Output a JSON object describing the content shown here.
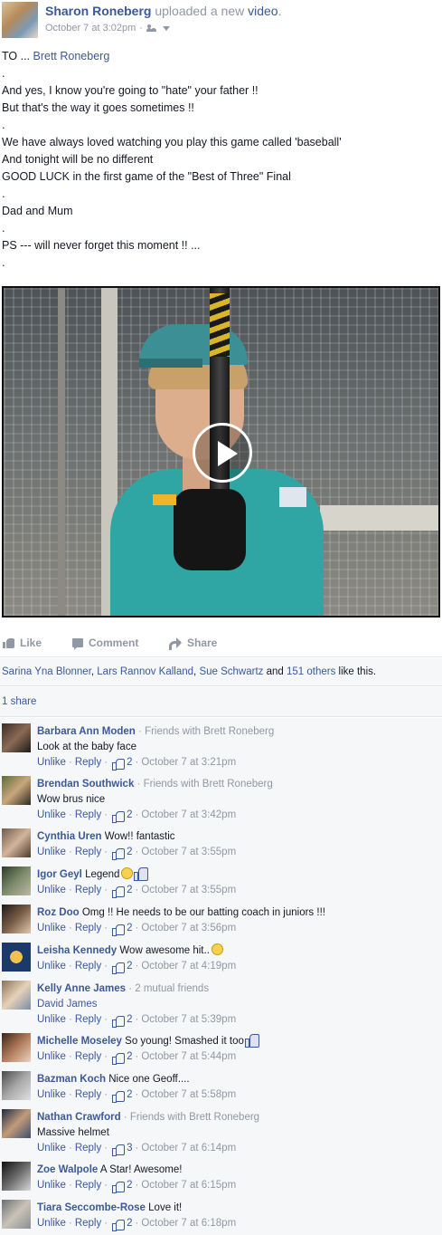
{
  "post": {
    "author": "Sharon Roneberg",
    "action_prefix": "uploaded a new",
    "action_link": "video",
    "action_suffix": ".",
    "timestamp": "October 7 at 3:02pm",
    "meta_separator": "·",
    "audience_icon": "friends-icon"
  },
  "text": {
    "to_prefix": "TO ... ",
    "to_name": "Brett Roneberg",
    "lines": [
      ".",
      "And yes, I know you're going to \"hate\" your father !!",
      "But that's the way it goes sometimes !!",
      ".",
      "We have always loved watching you play this game called 'baseball'",
      "And tonight will be no different",
      "GOOD LUCK in the first game of the \"Best of Three\" Final",
      ".",
      "Dad and Mum",
      ".",
      "PS --- will never forget this moment !! ...",
      "."
    ]
  },
  "actions": {
    "like": "Like",
    "comment": "Comment",
    "share": "Share"
  },
  "likes": {
    "names": [
      "Sarina Yna Blonner",
      "Lars Rannov Kalland",
      "Sue Schwartz"
    ],
    "sep1": ", ",
    "sep2": ", ",
    "and": " and ",
    "others": "151 others",
    "suffix": " like this."
  },
  "shares": {
    "label": "1 share"
  },
  "comments": [
    {
      "name": "Barbara Ann Moden",
      "note": "· Friends with Brett Roneberg",
      "text": "Look at the baby face",
      "unlike": "Unlike",
      "reply": "Reply",
      "likes": "2",
      "time": "October 7 at 3:21pm"
    },
    {
      "name": "Brendan Southwick",
      "note": "· Friends with Brett Roneberg",
      "text": "Wow brus nice",
      "unlike": "Unlike",
      "reply": "Reply",
      "likes": "2",
      "time": "October 7 at 3:42pm"
    },
    {
      "name": "Cynthia Uren",
      "text": "Wow!! fantastic",
      "unlike": "Unlike",
      "reply": "Reply",
      "likes": "2",
      "time": "October 7 at 3:55pm"
    },
    {
      "name": "Igor Geyl",
      "text": "Legend",
      "unlike": "Unlike",
      "reply": "Reply",
      "likes": "2",
      "time": "October 7 at 3:55pm"
    },
    {
      "name": "Roz Doo",
      "text": "Omg !! He needs to be our batting coach in juniors !!!",
      "unlike": "Unlike",
      "reply": "Reply",
      "likes": "2",
      "time": "October 7 at 3:56pm"
    },
    {
      "name": "Leisha Kennedy",
      "text": "Wow awesome hit..",
      "unlike": "Unlike",
      "reply": "Reply",
      "likes": "2",
      "time": "October 7 at 4:19pm"
    },
    {
      "name": "Kelly Anne James",
      "note": "· 2 mutual friends",
      "tag": "David James",
      "unlike": "Unlike",
      "reply": "Reply",
      "likes": "2",
      "time": "October 7 at 5:39pm"
    },
    {
      "name": "Michelle Moseley",
      "text": "So young! Smashed it too",
      "unlike": "Unlike",
      "reply": "Reply",
      "likes": "2",
      "time": "October 7 at 5:44pm"
    },
    {
      "name": "Bazman Koch",
      "text": "Nice one Geoff....",
      "unlike": "Unlike",
      "reply": "Reply",
      "likes": "2",
      "time": "October 7 at 5:58pm"
    },
    {
      "name": "Nathan Crawford",
      "note": "· Friends with Brett Roneberg",
      "text": "Massive helmet",
      "unlike": "Unlike",
      "reply": "Reply",
      "likes": "3",
      "time": "October 7 at 6:14pm"
    },
    {
      "name": "Zoe Walpole",
      "text": "A Star! Awesome!",
      "unlike": "Unlike",
      "reply": "Reply",
      "likes": "2",
      "time": "October 7 at 6:15pm"
    },
    {
      "name": "Tiara Seccombe-Rose",
      "text": "Love it!",
      "unlike": "Unlike",
      "reply": "Reply",
      "likes": "2",
      "time": "October 7 at 6:18pm"
    }
  ],
  "colors": {
    "link": "#3b5998",
    "muted": "#9197a3",
    "text": "#141823",
    "panel": "#f6f7f9"
  }
}
